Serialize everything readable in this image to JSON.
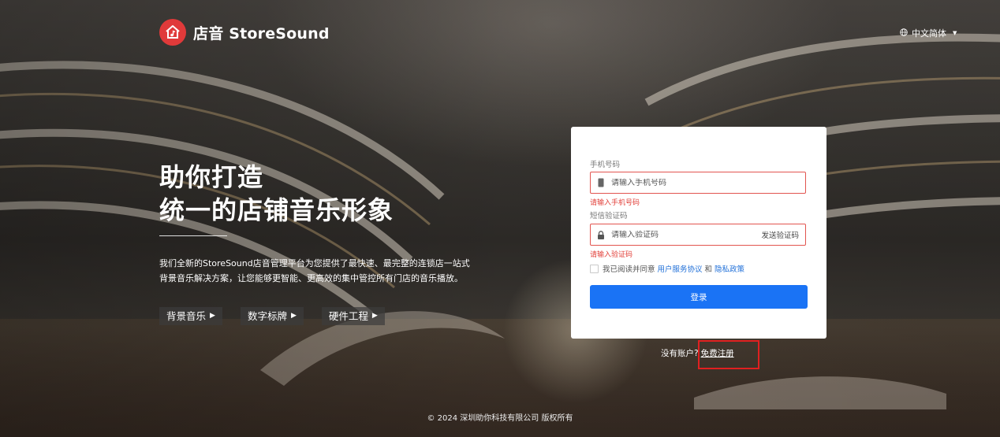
{
  "brand": {
    "name": "店音 StoreSound",
    "accent_color": "#e03a3a",
    "icon": "music-house-icon"
  },
  "language": {
    "label": "中文简体",
    "icon": "globe-icon",
    "dropdown_icon": "caret-down-icon"
  },
  "hero": {
    "title_line1": "助你打造",
    "title_line2": "统一的店铺音乐形象",
    "description_line1": "我们全新的StoreSound店音管理平台为您提供了最快速、最完整的连锁店一站式",
    "description_line2": "背景音乐解决方案，让您能够更智能、更高效的集中管控所有门店的音乐播放。",
    "buttons": [
      {
        "label": "背景音乐"
      },
      {
        "label": "数字标牌"
      },
      {
        "label": "硬件工程"
      }
    ]
  },
  "login": {
    "phone_label": "手机号码",
    "phone_placeholder": "请输入手机号码",
    "phone_value": "",
    "phone_error": "请输入手机号码",
    "code_label": "短信验证码",
    "code_placeholder": "请输入验证码",
    "code_value": "",
    "code_error": "请输入验证码",
    "send_code": "发送验证码",
    "agree_prefix": "我已阅读并同意",
    "terms_link": "用户服务协议",
    "agree_and": "和",
    "privacy_link": "隐私政策",
    "agreed": false,
    "submit": "登录",
    "primary_color": "#1a73f5",
    "error_color": "#e2403a"
  },
  "register": {
    "prompt": "没有账户?",
    "link": "免费注册"
  },
  "footer": {
    "copyright": "© 2024 深圳助你科技有限公司 版权所有"
  }
}
